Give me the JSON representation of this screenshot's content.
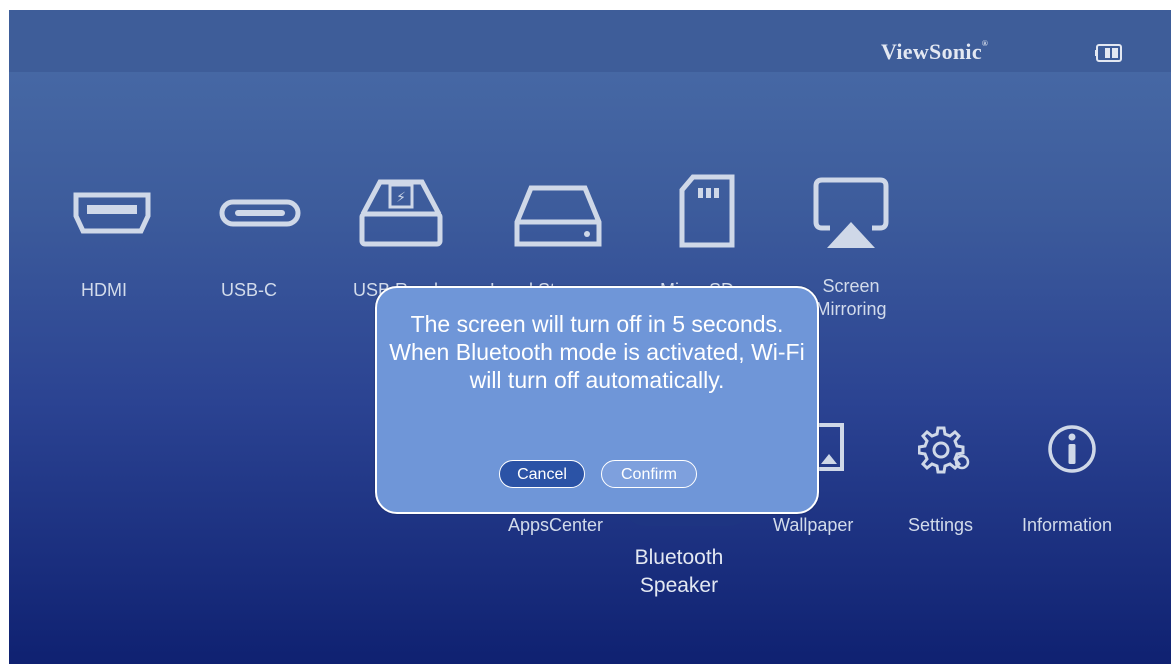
{
  "header": {
    "brand": "ViewSonic",
    "battery_icon": "battery-icon"
  },
  "sources": [
    {
      "label": "HDMI",
      "icon": "hdmi-icon"
    },
    {
      "label": "USB-C",
      "icon": "usb-c-icon"
    },
    {
      "label": "USB Reader",
      "icon": "usb-reader-icon"
    },
    {
      "label": "Local Storage",
      "icon": "local-storage-icon"
    },
    {
      "label": "Micro SD",
      "icon": "micro-sd-icon"
    },
    {
      "label": "Screen\nMirroring",
      "icon": "screen-mirroring-icon"
    }
  ],
  "apps": [
    {
      "label": "AppsCenter"
    },
    {
      "label": "Bluetooth\nSpeaker"
    },
    {
      "label": "Wallpaper",
      "icon": "wallpaper-icon"
    },
    {
      "label": "Settings",
      "icon": "gear-icon"
    },
    {
      "label": "Information",
      "icon": "info-icon"
    }
  ],
  "dialog": {
    "message": "The screen will turn off in 5 seconds. When Bluetooth mode is activated, Wi-Fi will turn off automatically.",
    "cancel_label": "Cancel",
    "confirm_label": "Confirm"
  },
  "colors": {
    "accent": "#2b53a6",
    "dialog_bg": "#6f96d8",
    "screen_top": "#4a6da8",
    "screen_bottom": "#0f2171"
  }
}
